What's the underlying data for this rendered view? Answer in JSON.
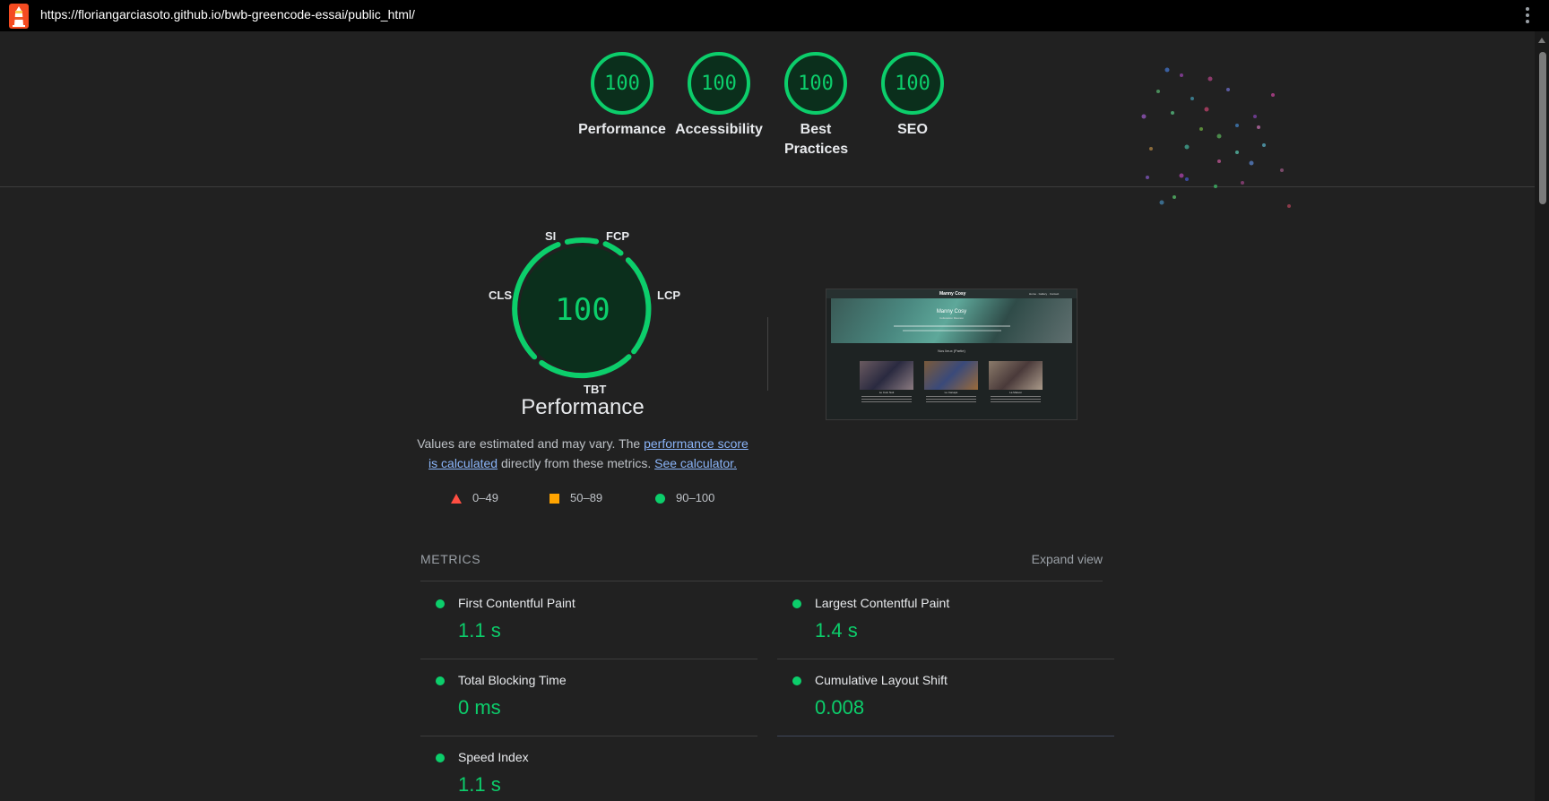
{
  "browser": {
    "url": "https://floriangarciasoto.github.io/bwb-greencode-essai/public_html/",
    "logo_icon": "lighthouse-icon"
  },
  "header_gauges": [
    {
      "score": "100",
      "label": "Performance"
    },
    {
      "score": "100",
      "label": "Accessibility"
    },
    {
      "score": "100",
      "label": "Best Practices"
    },
    {
      "score": "100",
      "label": "SEO"
    }
  ],
  "main_gauge": {
    "score": "100",
    "title": "Performance",
    "metric_labels": {
      "si": "SI",
      "fcp": "FCP",
      "lcp": "LCP",
      "tbt": "TBT",
      "cls": "CLS"
    }
  },
  "description": {
    "prefix": "Values are estimated and may vary. The ",
    "link1": "performance score is calculated",
    "middle": " directly from these metrics. ",
    "link2": "See calculator."
  },
  "legend": [
    {
      "range": "0–49",
      "shape": "triangle",
      "color": "#ff4e42"
    },
    {
      "range": "50–89",
      "shape": "square",
      "color": "#ffa400"
    },
    {
      "range": "90–100",
      "shape": "circle",
      "color": "#0cce6b"
    }
  ],
  "thumbnail": {
    "site_title": "Manny Cosy",
    "hero_title": "Manny Cosy",
    "hero_sub": "Collocation Réunion",
    "nav_links": "Home · Gallery · Contact",
    "section_title": "Nos lieux (Partie)",
    "cards": [
      "Le Coin Nuit",
      "Le Canapé",
      "La Maison"
    ]
  },
  "metrics": {
    "heading": "METRICS",
    "expand_label": "Expand view",
    "items": [
      {
        "name": "First Contentful Paint",
        "value": "1.1 s"
      },
      {
        "name": "Largest Contentful Paint",
        "value": "1.4 s"
      },
      {
        "name": "Total Blocking Time",
        "value": "0 ms"
      },
      {
        "name": "Cumulative Layout Shift",
        "value": "0.008"
      },
      {
        "name": "Speed Index",
        "value": "1.1 s"
      }
    ]
  },
  "colors": {
    "pass": "#0cce6b",
    "gauge_fill": "#0b2f1c",
    "background": "#212121"
  }
}
